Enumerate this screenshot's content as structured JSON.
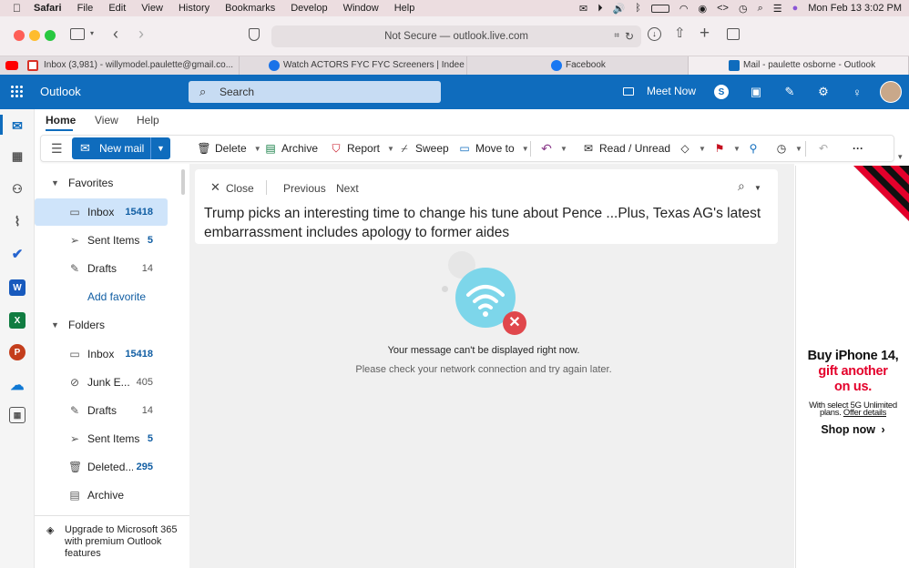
{
  "menubar": {
    "app": "Safari",
    "items": [
      "File",
      "Edit",
      "View",
      "History",
      "Bookmarks",
      "Develop",
      "Window",
      "Help"
    ],
    "datetime": "Mon Feb 13  3:02 PM"
  },
  "browser": {
    "url": "Not Secure — outlook.live.com",
    "tabs": [
      {
        "label": "Inbox (3,981) - willymodel.paulette@gmail.co..."
      },
      {
        "label": "Watch ACTORS FYC FYC Screeners | Indee"
      },
      {
        "label": "Facebook"
      },
      {
        "label": "Mail - paulette osborne - Outlook"
      }
    ]
  },
  "outlook": {
    "app_name": "Outlook",
    "search_placeholder": "Search",
    "meet_now": "Meet Now",
    "ribbon_tabs": [
      "Home",
      "View",
      "Help"
    ],
    "toolbar": {
      "new_mail": "New mail",
      "delete": "Delete",
      "archive": "Archive",
      "report": "Report",
      "sweep": "Sweep",
      "move_to": "Move to",
      "read_unread": "Read / Unread"
    },
    "favorites_label": "Favorites",
    "folders_label": "Folders",
    "favorites": [
      {
        "name": "Inbox",
        "count": "15418"
      },
      {
        "name": "Sent Items",
        "count": "5"
      },
      {
        "name": "Drafts",
        "count": "14"
      }
    ],
    "add_favorite": "Add favorite",
    "folders": [
      {
        "name": "Inbox",
        "count": "15418"
      },
      {
        "name": "Junk E...",
        "count": "405"
      },
      {
        "name": "Drafts",
        "count": "14"
      },
      {
        "name": "Sent Items",
        "count": "5"
      },
      {
        "name": "Deleted...",
        "count": "295"
      },
      {
        "name": "Archive",
        "count": ""
      }
    ],
    "upgrade_text": "Upgrade to Microsoft 365 with premium Outlook features",
    "reading": {
      "close": "Close",
      "previous": "Previous",
      "next": "Next",
      "subject": "Trump picks an interesting time to change his tune about Pence ...Plus, Texas AG's latest embarrassment includes apology to former aides",
      "error_title": "Your message can't be displayed right now.",
      "error_detail": "Please check your network connection and try again later."
    },
    "ad": {
      "line1": "Buy iPhone 14,",
      "line2": "gift another",
      "line3": "on us.",
      "fine_print_1": "With select 5G Unlimited",
      "fine_print_2": "plans.",
      "offer_link": "Offer details",
      "cta": "Shop now"
    }
  },
  "colors": {
    "brand": "#0f6cbd",
    "ad_red": "#e4002b",
    "selected": "#cfe4fa"
  }
}
